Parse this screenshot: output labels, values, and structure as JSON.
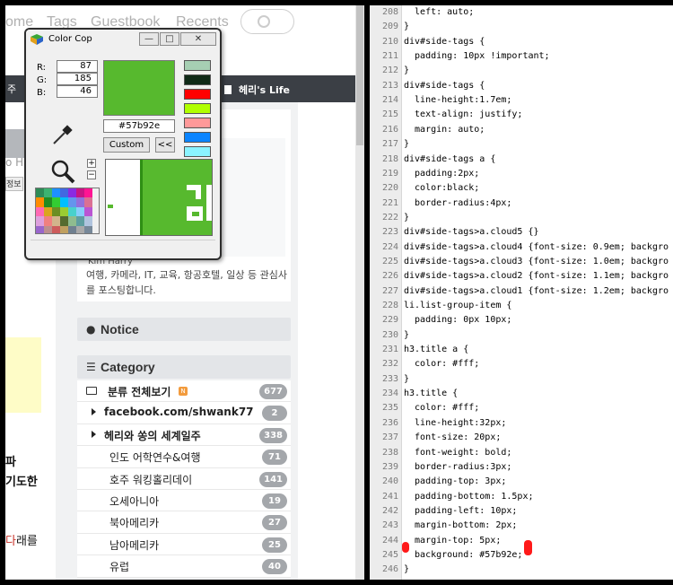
{
  "browser": {
    "nav": [
      "ome",
      "Tags",
      "Guestbook",
      "Recents"
    ],
    "dark_bar_stub": "주",
    "blog_title": "헤리's Life",
    "left_partial": {
      "ha_text": "o Ha",
      "btn_text": "정보",
      "line1": "파",
      "line2": "기도한",
      "line3_red": "다",
      "line3_rest": "래를"
    },
    "profile": {
      "name": "Kim Harry",
      "desc": "여행, 카메라, IT, 교육, 항공호텔, 일상 등 관심사를 포스팅합니다."
    },
    "notice_title": "Notice",
    "category_title": "Category",
    "categories": [
      {
        "label": "분류 전체보기",
        "count": "677",
        "level": 0,
        "new": true,
        "new_label": "N"
      },
      {
        "label": "facebook.com/shwank77",
        "count": "2",
        "level": 1
      },
      {
        "label": "헤리와 쏭의 세계일주",
        "count": "338",
        "level": 1
      },
      {
        "label": "인도 어학연수&여행",
        "count": "71",
        "level": 2
      },
      {
        "label": "호주 워킹홀리데이",
        "count": "141",
        "level": 2
      },
      {
        "label": "오세아니아",
        "count": "19",
        "level": 2
      },
      {
        "label": "북아메리카",
        "count": "27",
        "level": 2
      },
      {
        "label": "남아메리카",
        "count": "25",
        "level": 2
      },
      {
        "label": "유럽",
        "count": "40",
        "level": 2
      }
    ]
  },
  "colorcop": {
    "title": "Color Cop",
    "rgb": {
      "r_label": "R:",
      "g_label": "G:",
      "b_label": "B:",
      "r": "87",
      "g": "185",
      "b": "46"
    },
    "hex": "#57b92e",
    "custom_label": "Custom",
    "expand_label": "<<",
    "current_color": "#57b92e",
    "history": [
      "#a6cfb3",
      "#0f2a17",
      "#ff0000",
      "#b0ff00",
      "#ff9999",
      "#0a84ff",
      "#8af3ff"
    ],
    "plus": "+",
    "minus": "−"
  },
  "editor": {
    "lines": [
      {
        "n": "208",
        "t": "  left: auto;"
      },
      {
        "n": "209",
        "t": "}"
      },
      {
        "n": "210",
        "t": "div#side-tags {"
      },
      {
        "n": "211",
        "t": "  padding: 10px !important;"
      },
      {
        "n": "212",
        "t": "}"
      },
      {
        "n": "213",
        "t": "div#side-tags {"
      },
      {
        "n": "214",
        "t": "  line-height:1.7em;"
      },
      {
        "n": "215",
        "t": "  text-align: justify;"
      },
      {
        "n": "216",
        "t": "  margin: auto;"
      },
      {
        "n": "217",
        "t": "}"
      },
      {
        "n": "218",
        "t": "div#side-tags a {"
      },
      {
        "n": "219",
        "t": "  padding:2px;"
      },
      {
        "n": "220",
        "t": "  color:black;"
      },
      {
        "n": "221",
        "t": "  border-radius:4px;"
      },
      {
        "n": "222",
        "t": "}"
      },
      {
        "n": "223",
        "t": "div#side-tags>a.cloud5 {}"
      },
      {
        "n": "224",
        "t": "div#side-tags>a.cloud4 {font-size: 0.9em; backgro"
      },
      {
        "n": "225",
        "t": "div#side-tags>a.cloud3 {font-size: 1.0em; backgro"
      },
      {
        "n": "226",
        "t": "div#side-tags>a.cloud2 {font-size: 1.1em; backgro"
      },
      {
        "n": "227",
        "t": "div#side-tags>a.cloud1 {font-size: 1.2em; backgro"
      },
      {
        "n": "228",
        "t": "li.list-group-item {"
      },
      {
        "n": "229",
        "t": "  padding: 0px 10px;"
      },
      {
        "n": "230",
        "t": "}"
      },
      {
        "n": "231",
        "t": "h3.title a {"
      },
      {
        "n": "232",
        "t": "  color: #fff;"
      },
      {
        "n": "233",
        "t": "}"
      },
      {
        "n": "234",
        "t": "h3.title {"
      },
      {
        "n": "235",
        "t": "  color: #fff;"
      },
      {
        "n": "236",
        "t": "  line-height:32px;"
      },
      {
        "n": "237",
        "t": "  font-size: 20px;"
      },
      {
        "n": "238",
        "t": "  font-weight: bold;"
      },
      {
        "n": "239",
        "t": "  border-radius:3px;"
      },
      {
        "n": "240",
        "t": "  padding-top: 3px;"
      },
      {
        "n": "241",
        "t": "  padding-bottom: 1.5px;"
      },
      {
        "n": "242",
        "t": "  padding-left: 10px;"
      },
      {
        "n": "243",
        "t": "  margin-bottom: 2px;"
      },
      {
        "n": "244",
        "t": "  margin-top: 5px;"
      },
      {
        "n": "245",
        "t": "  background: #57b92e;"
      },
      {
        "n": "246",
        "t": "}"
      }
    ]
  }
}
